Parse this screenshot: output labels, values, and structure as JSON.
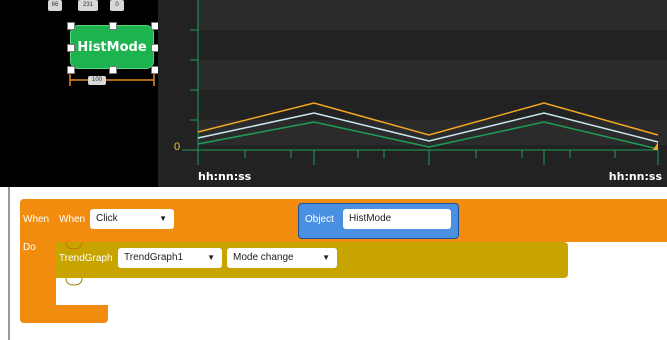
{
  "canvas": {
    "top_values": [
      "66",
      "231",
      "0"
    ],
    "button_label": "HistMode",
    "width_value": "100",
    "height_value": "50"
  },
  "trend": {
    "zero_label": "0",
    "left_time": "hh:nn:ss",
    "right_time": "hh:nn:ss",
    "line_colors": [
      "#f5a623",
      "#c8e6f0",
      "#1d9e55"
    ]
  },
  "blocks": {
    "when_outer": "When",
    "do_label": "Do",
    "when_inner": "When",
    "event_value": "Click",
    "object_label": "Object",
    "object_value": "HistMode",
    "action_label": "TrendGraph",
    "target_value": "TrendGraph1",
    "method_value": "Mode change",
    "colors": {
      "event": "#f28c0f",
      "object": "#4a90e2",
      "action": "#c7a400"
    }
  }
}
